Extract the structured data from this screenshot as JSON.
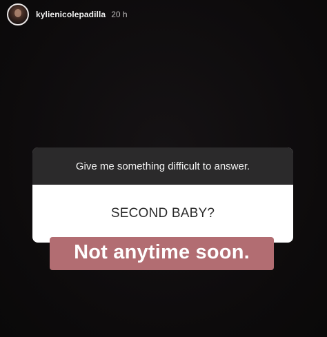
{
  "story": {
    "user": {
      "avatar_icon": "profile-photo",
      "username": "kylienicolepadilla",
      "time_posted": "20 h"
    },
    "question_sticker": {
      "prompt": "Give me something difficult to answer.",
      "question": "SECOND BABY?"
    },
    "reply": {
      "text": "Not anytime soon.",
      "highlight_color": "#b26d72"
    }
  }
}
